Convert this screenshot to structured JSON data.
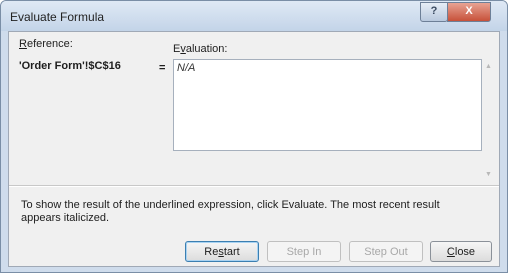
{
  "window": {
    "title": "Evaluate Formula",
    "help_label": "?",
    "close_label": "X"
  },
  "reference": {
    "label_first": "R",
    "label_rest": "eference:",
    "value": "'Order Form'!$C$16"
  },
  "equals": "=",
  "evaluation": {
    "label_first": "E",
    "label_underlined": "v",
    "label_rest": "aluation:",
    "value": "N/A"
  },
  "info_text": "To show the result of the underlined expression, click Evaluate.  The most recent result appears italicized.",
  "buttons": {
    "restart": {
      "pre": "Re",
      "u": "s",
      "post": "tart",
      "enabled": true
    },
    "step_in": {
      "label": "Step In",
      "enabled": false
    },
    "step_out": {
      "label": "Step Out",
      "enabled": false
    },
    "close": {
      "pre": "",
      "u": "C",
      "post": "lose",
      "enabled": true
    }
  }
}
